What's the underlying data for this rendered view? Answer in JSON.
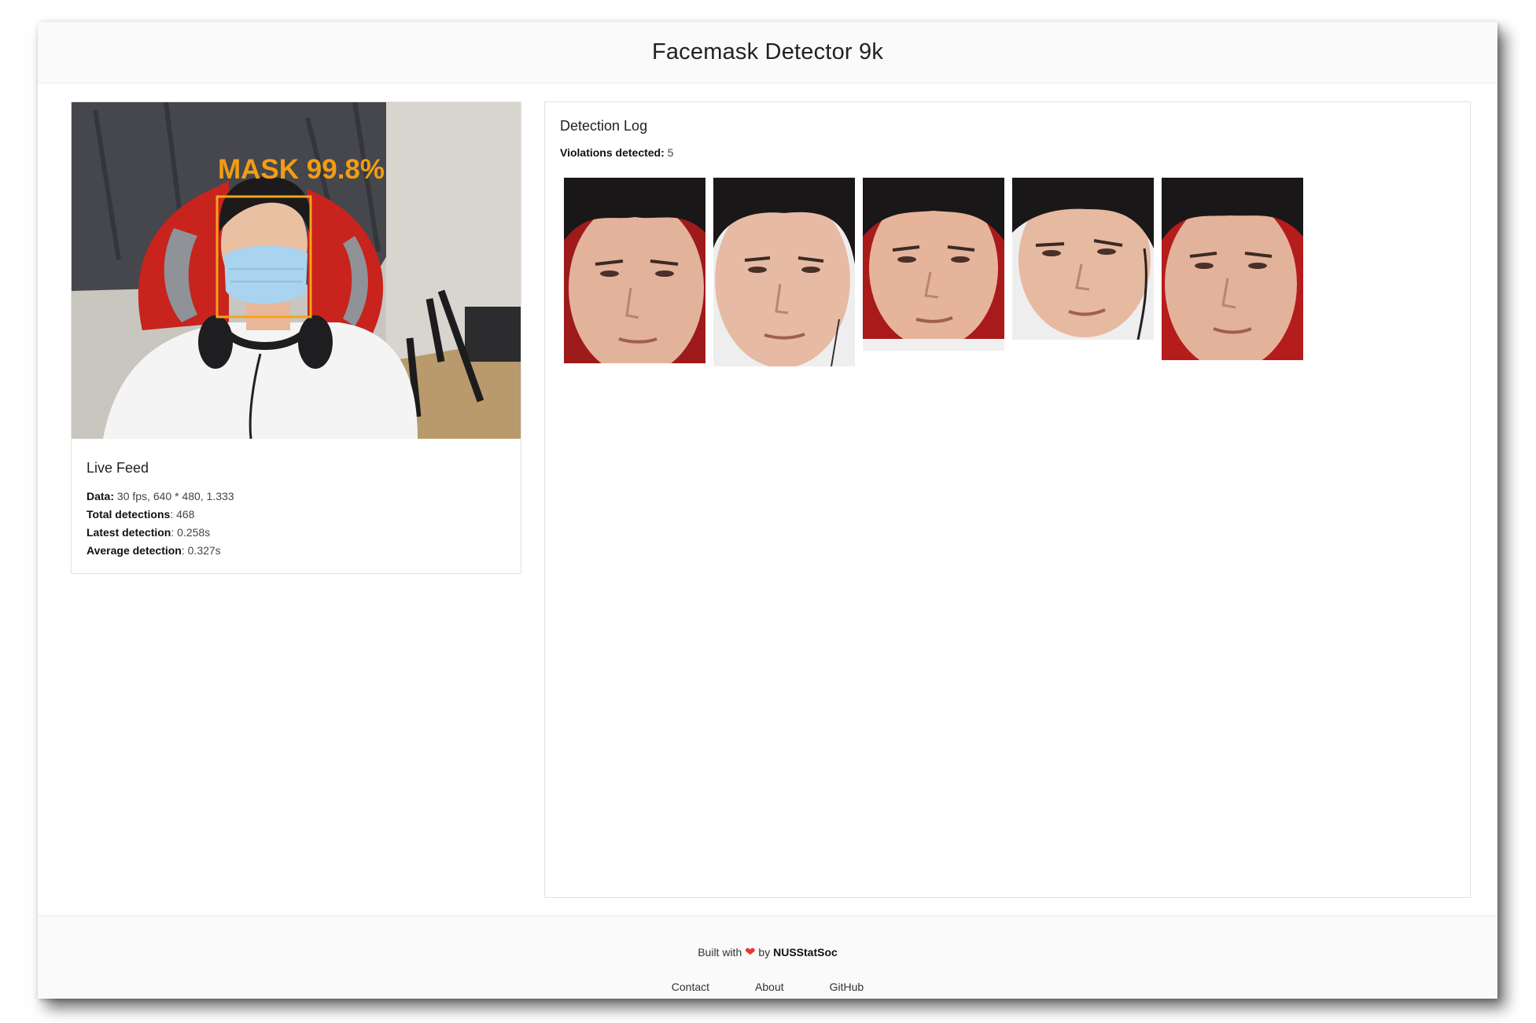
{
  "header": {
    "title": "Facemask Detector 9k"
  },
  "live_feed": {
    "overlay_label": "MASK 99.8%",
    "title": "Live Feed",
    "stats": [
      {
        "label": "Data:",
        "value": " 30 fps, 640 * 480, 1.333"
      },
      {
        "label": "Total detections",
        "value": ": 468"
      },
      {
        "label": "Latest detection",
        "value": ": 0.258s"
      },
      {
        "label": "Average detection",
        "value": ": 0.327s"
      }
    ]
  },
  "detection_log": {
    "title": "Detection Log",
    "violations_label": "Violations detected:",
    "violations_value": " 5"
  },
  "footer": {
    "built_prefix": "Built with",
    "built_heart": "❤",
    "built_by": "by",
    "org": "NUSStatSoc",
    "links": [
      "Contact",
      "About",
      "GitHub"
    ]
  },
  "colors": {
    "bbox": "#f4a41c",
    "overlay_text": "#f29d12",
    "mask": "#a9d3ee"
  }
}
